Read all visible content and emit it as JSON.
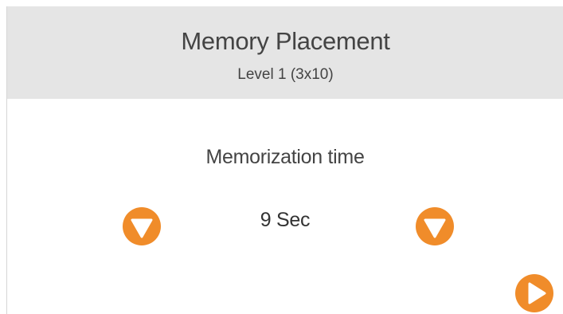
{
  "header": {
    "title": "Memory Placement",
    "subtitle": "Level 1 (3x10)"
  },
  "setting": {
    "label": "Memorization time",
    "value": "9 Sec"
  },
  "icons": {
    "decrease": "triangle-down-icon",
    "increase": "triangle-down-icon",
    "next": "play-icon"
  },
  "colors": {
    "accent": "#f08c2a",
    "header_bg": "#e5e5e5",
    "text": "#444444"
  }
}
